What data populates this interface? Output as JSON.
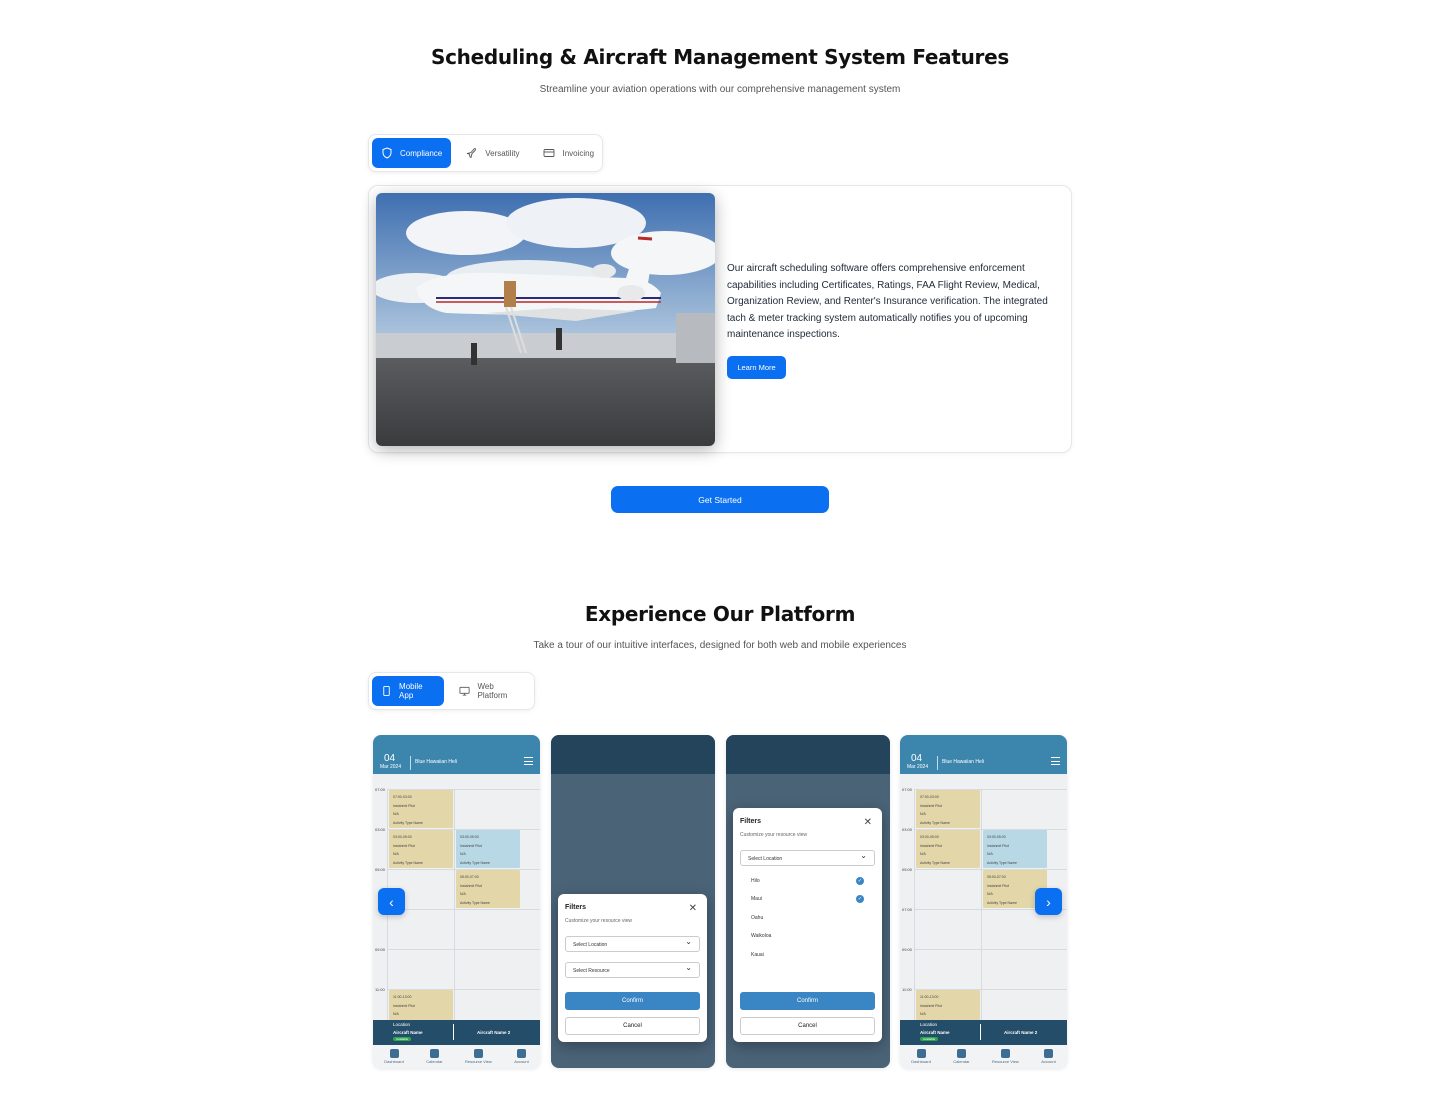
{
  "features": {
    "title": "Scheduling & Aircraft Management System Features",
    "subtitle": "Streamline your aviation operations with our comprehensive management system",
    "tabs": [
      {
        "label": "Compliance",
        "icon": "shield-icon",
        "active": true
      },
      {
        "label": "Versatility",
        "icon": "plane-icon",
        "active": false
      },
      {
        "label": "Invoicing",
        "icon": "credit-card-icon",
        "active": false
      }
    ],
    "description": "Our aircraft scheduling software offers comprehensive enforcement capabilities including Certificates, Ratings, FAA Flight Review, Medical, Organization Review, and Renter's Insurance verification. The integrated tach & meter tracking system automatically notifies you of upcoming maintenance inspections.",
    "learn_more": "Learn More",
    "get_started": "Get Started"
  },
  "platform": {
    "title": "Experience Our Platform",
    "subtitle": "Take a tour of our intuitive interfaces, designed for both web and mobile experiences",
    "tabs": [
      {
        "label": "Mobile App",
        "icon": "smartphone-icon",
        "active": true
      },
      {
        "label": "Web Platform",
        "icon": "monitor-icon",
        "active": false
      }
    ]
  },
  "phone": {
    "day": "04",
    "month": "Mar 2024",
    "resource": "Blue Hawaiian Heli",
    "times": [
      "07:00",
      "03:00",
      "05:00",
      "07:00",
      "09:00",
      "11:00"
    ],
    "event_time_a": "07:00-03:00",
    "event_time_b": "03:00-05:00",
    "event_time_c": "05:00-07:00",
    "event_time_d": "11:00-13:00",
    "event_pilot": "Instahmit Pilot",
    "event_person": "N/A",
    "event_activity": "Activity Type Name",
    "event_pilot_b": "Instahmit Pilot",
    "footer_location": "Location",
    "aircraft_1": "Aircraft Name",
    "aircraft_2": "Aircraft Name 2",
    "badge": "Available",
    "nav": [
      "Dashboard",
      "Calendar",
      "Resource View",
      "Account"
    ]
  },
  "filters": {
    "title": "Filters",
    "subtitle": "Customize your resource view",
    "select_location": "Select Location",
    "select_resource": "Select Resource",
    "confirm": "Confirm",
    "cancel": "Cancel",
    "locations": [
      "Hilo",
      "Maui",
      "Oahu",
      "Waikoloa",
      "Kauai"
    ]
  },
  "colors": {
    "accent": "#0a6ff0",
    "header": "#3c86ad",
    "event_yellow": "#e3d6a8",
    "event_blue": "#b8d8e6"
  }
}
